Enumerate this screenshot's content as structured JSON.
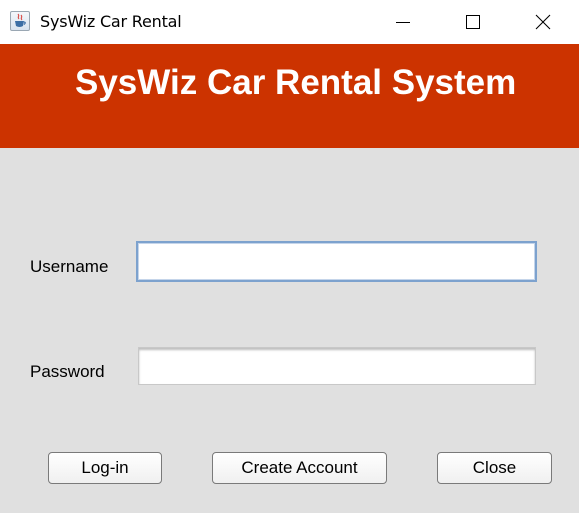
{
  "window": {
    "title": "SysWiz Car Rental",
    "icon": "java-cup-icon",
    "controls": {
      "minimize_icon": "minimize-icon",
      "maximize_icon": "maximize-icon",
      "close_icon": "close-icon"
    }
  },
  "header": {
    "title": "SysWiz Car Rental System",
    "background_color": "#cc3300",
    "text_color": "#ffffff"
  },
  "form": {
    "username": {
      "label": "Username",
      "value": ""
    },
    "password": {
      "label": "Password",
      "value": ""
    }
  },
  "buttons": {
    "login_label": "Log-in",
    "create_account_label": "Create Account",
    "close_label": "Close"
  },
  "colors": {
    "panel_background": "#e0e0e0",
    "focus_border": "#7da2ce"
  }
}
